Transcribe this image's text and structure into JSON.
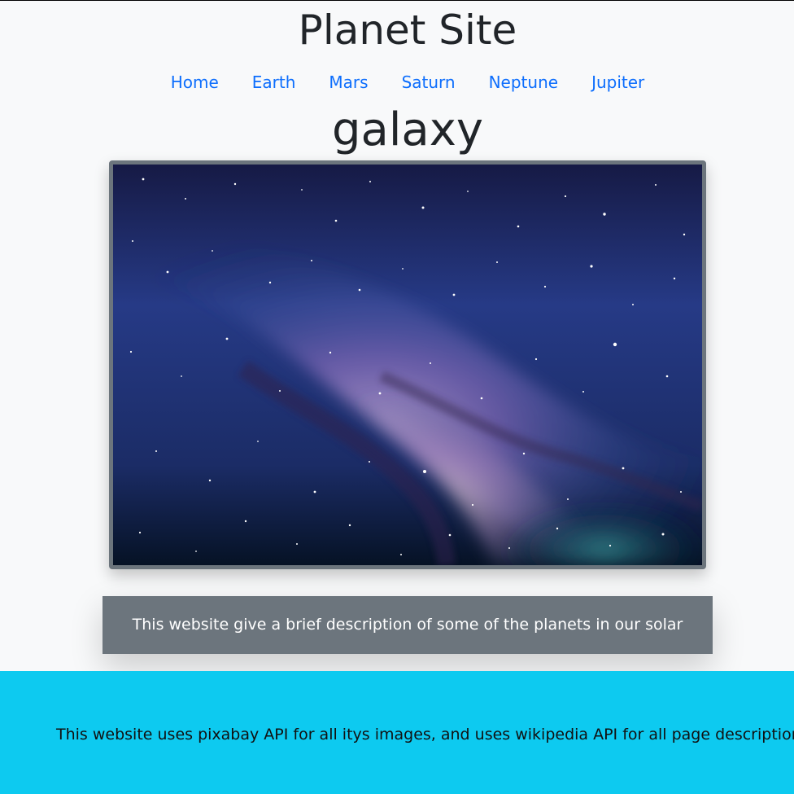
{
  "header": {
    "site_title": "Planet Site"
  },
  "nav": {
    "items": [
      {
        "label": "Home"
      },
      {
        "label": "Earth"
      },
      {
        "label": "Mars"
      },
      {
        "label": "Saturn"
      },
      {
        "label": "Neptune"
      },
      {
        "label": "Jupiter"
      }
    ]
  },
  "main": {
    "page_heading": "galaxy",
    "image_description": "galaxy image",
    "description": "This website give a brief description of some of the planets in our solar system!"
  },
  "footer": {
    "text": "This website uses pixabay API for all itys images, and uses wikipedia API for all page descriptions"
  },
  "colors": {
    "page_background": "#f8f9fa",
    "nav_link": "#0d6efd",
    "image_border": "#6c757d",
    "description_background": "#6c757d",
    "footer_background": "#0dcaf0"
  },
  "icons": {
    "image": "galaxy-image"
  }
}
